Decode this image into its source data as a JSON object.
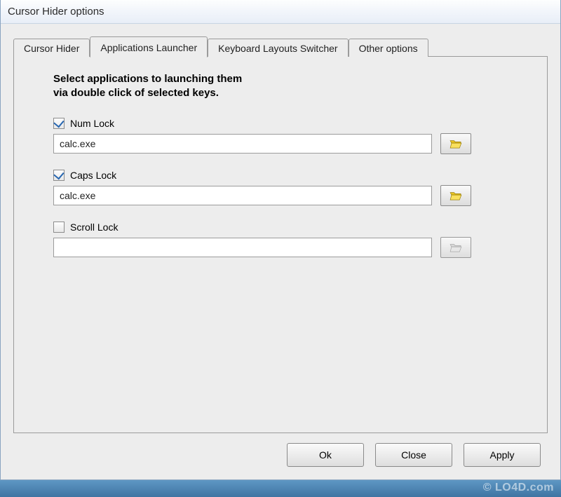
{
  "window": {
    "title": "Cursor Hider options"
  },
  "tabs": {
    "items": [
      {
        "label": "Cursor Hider",
        "active": false
      },
      {
        "label": "Applications Launcher",
        "active": true
      },
      {
        "label": "Keyboard Layouts Switcher",
        "active": false
      },
      {
        "label": "Other options",
        "active": false
      }
    ]
  },
  "panel": {
    "instruction_line1": "Select applications to launching them",
    "instruction_line2": "via double click of selected keys.",
    "fields": [
      {
        "key": "numlock",
        "label": "Num Lock",
        "checked": true,
        "value": "calc.exe",
        "browse_enabled": true
      },
      {
        "key": "capslock",
        "label": "Caps Lock",
        "checked": true,
        "value": "calc.exe",
        "browse_enabled": true
      },
      {
        "key": "scrolllock",
        "label": "Scroll Lock",
        "checked": false,
        "value": "",
        "browse_enabled": false
      }
    ]
  },
  "buttons": {
    "ok": "Ok",
    "close": "Close",
    "apply": "Apply"
  },
  "watermark": "© LO4D.com"
}
